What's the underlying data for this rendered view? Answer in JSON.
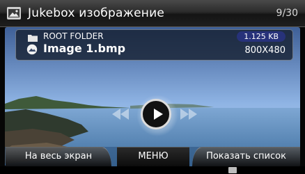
{
  "header": {
    "title": "Jukebox изображение",
    "counter": "9/30",
    "icon": "photo-app-icon"
  },
  "info": {
    "folder_label": "ROOT FOLDER",
    "folder_icon": "folder-icon",
    "file_name": "Image 1.bmp",
    "file_icon": "image-file-icon",
    "file_size": "1.125 KB",
    "resolution": "800X480"
  },
  "controls": {
    "prev_icon": "previous-icon",
    "play_icon": "play-icon",
    "next_icon": "next-icon"
  },
  "softkeys": {
    "left": "На весь экран",
    "middle": "МЕНЮ",
    "right": "Показать список"
  },
  "colors": {
    "sky": "#8fb4e4",
    "sea": "#5f8fbf",
    "badge": "#27327a"
  }
}
